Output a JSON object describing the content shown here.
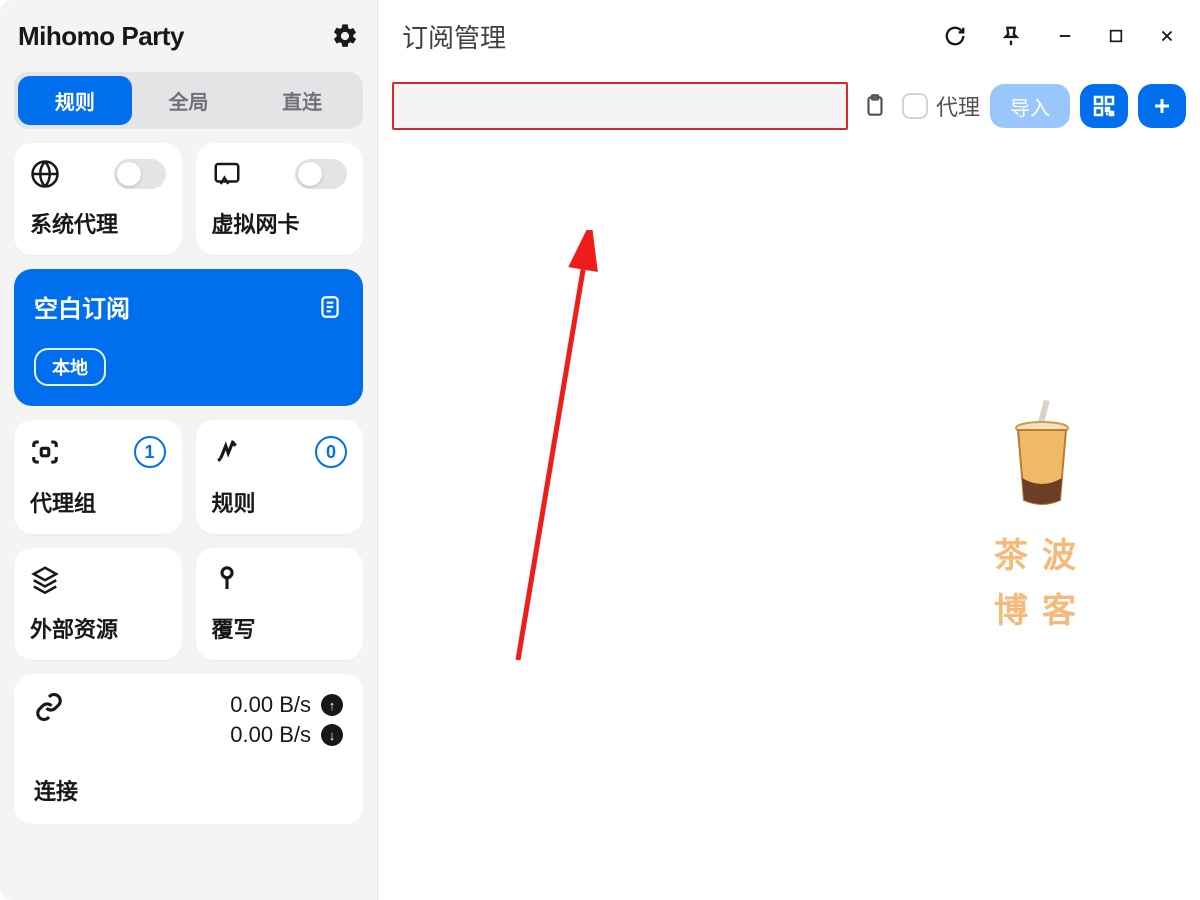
{
  "app": {
    "title": "Mihomo Party"
  },
  "modes": {
    "rules": "规则",
    "global": "全局",
    "direct": "直连"
  },
  "cards": {
    "system_proxy": "系统代理",
    "tun": "虚拟网卡"
  },
  "subscription": {
    "title": "空白订阅",
    "badge": "本地"
  },
  "proxy_group": {
    "label": "代理组",
    "count": "1"
  },
  "rules_card": {
    "label": "规则",
    "count": "0"
  },
  "resources": {
    "label": "外部资源"
  },
  "override": {
    "label": "覆写"
  },
  "speed": {
    "up": "0.00 B/s",
    "down": "0.00 B/s",
    "label": "连接"
  },
  "main": {
    "title": "订阅管理",
    "proxy_label": "代理",
    "import_label": "导入"
  },
  "watermark": {
    "line1": "茶波",
    "line2": "博客"
  }
}
